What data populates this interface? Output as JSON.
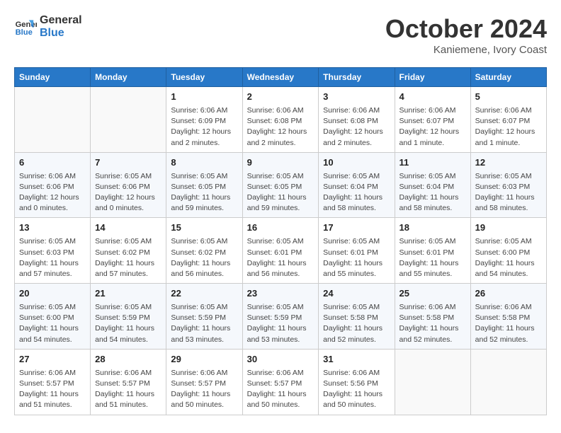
{
  "header": {
    "logo_line1": "General",
    "logo_line2": "Blue",
    "month": "October 2024",
    "location": "Kaniemene, Ivory Coast"
  },
  "days_of_week": [
    "Sunday",
    "Monday",
    "Tuesday",
    "Wednesday",
    "Thursday",
    "Friday",
    "Saturday"
  ],
  "weeks": [
    [
      {
        "day": "",
        "info": ""
      },
      {
        "day": "",
        "info": ""
      },
      {
        "day": "1",
        "info": "Sunrise: 6:06 AM\nSunset: 6:09 PM\nDaylight: 12 hours\nand 2 minutes."
      },
      {
        "day": "2",
        "info": "Sunrise: 6:06 AM\nSunset: 6:08 PM\nDaylight: 12 hours\nand 2 minutes."
      },
      {
        "day": "3",
        "info": "Sunrise: 6:06 AM\nSunset: 6:08 PM\nDaylight: 12 hours\nand 2 minutes."
      },
      {
        "day": "4",
        "info": "Sunrise: 6:06 AM\nSunset: 6:07 PM\nDaylight: 12 hours\nand 1 minute."
      },
      {
        "day": "5",
        "info": "Sunrise: 6:06 AM\nSunset: 6:07 PM\nDaylight: 12 hours\nand 1 minute."
      }
    ],
    [
      {
        "day": "6",
        "info": "Sunrise: 6:06 AM\nSunset: 6:06 PM\nDaylight: 12 hours\nand 0 minutes."
      },
      {
        "day": "7",
        "info": "Sunrise: 6:05 AM\nSunset: 6:06 PM\nDaylight: 12 hours\nand 0 minutes."
      },
      {
        "day": "8",
        "info": "Sunrise: 6:05 AM\nSunset: 6:05 PM\nDaylight: 11 hours\nand 59 minutes."
      },
      {
        "day": "9",
        "info": "Sunrise: 6:05 AM\nSunset: 6:05 PM\nDaylight: 11 hours\nand 59 minutes."
      },
      {
        "day": "10",
        "info": "Sunrise: 6:05 AM\nSunset: 6:04 PM\nDaylight: 11 hours\nand 58 minutes."
      },
      {
        "day": "11",
        "info": "Sunrise: 6:05 AM\nSunset: 6:04 PM\nDaylight: 11 hours\nand 58 minutes."
      },
      {
        "day": "12",
        "info": "Sunrise: 6:05 AM\nSunset: 6:03 PM\nDaylight: 11 hours\nand 58 minutes."
      }
    ],
    [
      {
        "day": "13",
        "info": "Sunrise: 6:05 AM\nSunset: 6:03 PM\nDaylight: 11 hours\nand 57 minutes."
      },
      {
        "day": "14",
        "info": "Sunrise: 6:05 AM\nSunset: 6:02 PM\nDaylight: 11 hours\nand 57 minutes."
      },
      {
        "day": "15",
        "info": "Sunrise: 6:05 AM\nSunset: 6:02 PM\nDaylight: 11 hours\nand 56 minutes."
      },
      {
        "day": "16",
        "info": "Sunrise: 6:05 AM\nSunset: 6:01 PM\nDaylight: 11 hours\nand 56 minutes."
      },
      {
        "day": "17",
        "info": "Sunrise: 6:05 AM\nSunset: 6:01 PM\nDaylight: 11 hours\nand 55 minutes."
      },
      {
        "day": "18",
        "info": "Sunrise: 6:05 AM\nSunset: 6:01 PM\nDaylight: 11 hours\nand 55 minutes."
      },
      {
        "day": "19",
        "info": "Sunrise: 6:05 AM\nSunset: 6:00 PM\nDaylight: 11 hours\nand 54 minutes."
      }
    ],
    [
      {
        "day": "20",
        "info": "Sunrise: 6:05 AM\nSunset: 6:00 PM\nDaylight: 11 hours\nand 54 minutes."
      },
      {
        "day": "21",
        "info": "Sunrise: 6:05 AM\nSunset: 5:59 PM\nDaylight: 11 hours\nand 54 minutes."
      },
      {
        "day": "22",
        "info": "Sunrise: 6:05 AM\nSunset: 5:59 PM\nDaylight: 11 hours\nand 53 minutes."
      },
      {
        "day": "23",
        "info": "Sunrise: 6:05 AM\nSunset: 5:59 PM\nDaylight: 11 hours\nand 53 minutes."
      },
      {
        "day": "24",
        "info": "Sunrise: 6:05 AM\nSunset: 5:58 PM\nDaylight: 11 hours\nand 52 minutes."
      },
      {
        "day": "25",
        "info": "Sunrise: 6:06 AM\nSunset: 5:58 PM\nDaylight: 11 hours\nand 52 minutes."
      },
      {
        "day": "26",
        "info": "Sunrise: 6:06 AM\nSunset: 5:58 PM\nDaylight: 11 hours\nand 52 minutes."
      }
    ],
    [
      {
        "day": "27",
        "info": "Sunrise: 6:06 AM\nSunset: 5:57 PM\nDaylight: 11 hours\nand 51 minutes."
      },
      {
        "day": "28",
        "info": "Sunrise: 6:06 AM\nSunset: 5:57 PM\nDaylight: 11 hours\nand 51 minutes."
      },
      {
        "day": "29",
        "info": "Sunrise: 6:06 AM\nSunset: 5:57 PM\nDaylight: 11 hours\nand 50 minutes."
      },
      {
        "day": "30",
        "info": "Sunrise: 6:06 AM\nSunset: 5:57 PM\nDaylight: 11 hours\nand 50 minutes."
      },
      {
        "day": "31",
        "info": "Sunrise: 6:06 AM\nSunset: 5:56 PM\nDaylight: 11 hours\nand 50 minutes."
      },
      {
        "day": "",
        "info": ""
      },
      {
        "day": "",
        "info": ""
      }
    ]
  ]
}
